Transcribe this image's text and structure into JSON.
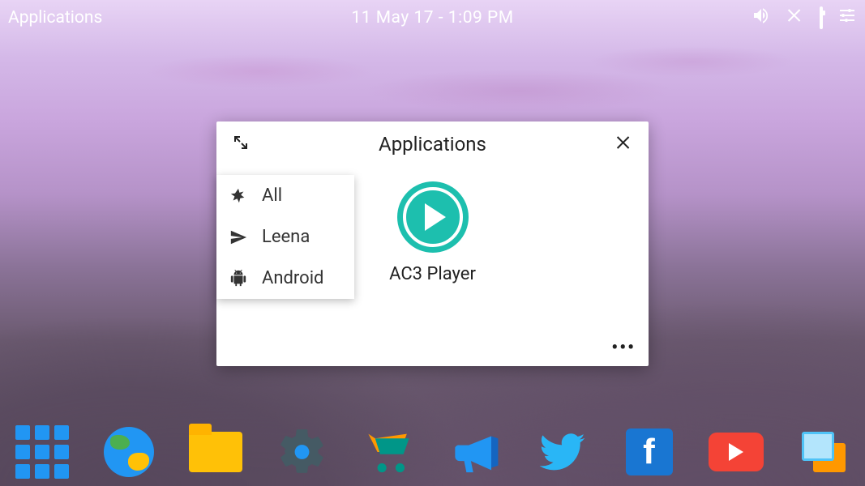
{
  "topbar": {
    "apps_label": "Applications",
    "datetime": "11 May 17 - 1:09 PM"
  },
  "window": {
    "title": "Applications",
    "filters": [
      {
        "icon": "asterisk",
        "label": "All"
      },
      {
        "icon": "send",
        "label": "Leena"
      },
      {
        "icon": "android",
        "label": "Android"
      }
    ],
    "apps": [
      {
        "name": "AC3 Player",
        "icon": "play-circle-teal"
      }
    ],
    "more": "•••"
  },
  "dock": {
    "items": [
      "app-grid",
      "browser-globe",
      "files-folder",
      "settings-gear",
      "store-cart",
      "announcements-bullhorn",
      "twitter",
      "facebook",
      "youtube",
      "multitask-screens"
    ],
    "fb_letter": "f"
  }
}
